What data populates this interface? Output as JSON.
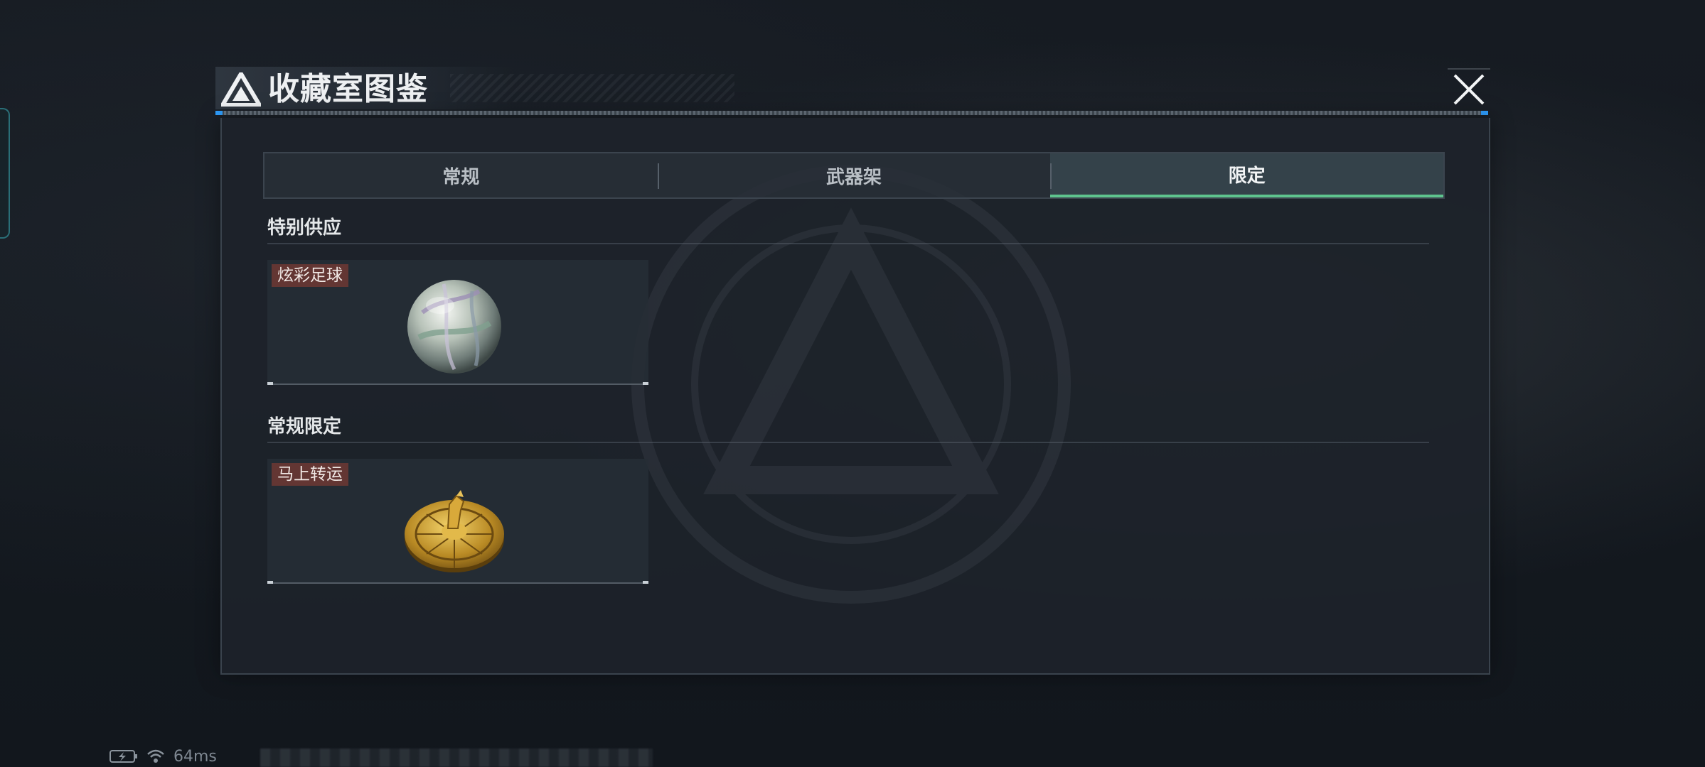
{
  "dialog": {
    "title": "收藏室图鉴",
    "close_icon": "close-icon"
  },
  "tabs": [
    {
      "label": "常规",
      "active": false
    },
    {
      "label": "武器架",
      "active": false
    },
    {
      "label": "限定",
      "active": true
    }
  ],
  "sections": [
    {
      "title": "特别供应",
      "items": [
        {
          "name": "炫彩足球",
          "icon": "iridescent-football-icon"
        }
      ]
    },
    {
      "title": "常规限定",
      "items": [
        {
          "name": "马上转运",
          "icon": "golden-horse-disc-icon"
        }
      ]
    }
  ],
  "status": {
    "ping": "64ms",
    "battery_icon": "battery-charging-icon",
    "wifi_icon": "wifi-icon"
  },
  "colors": {
    "active_tab_underline": "#5ec48e",
    "tag_background": "#6e3834",
    "panel_background": "#1d232a"
  }
}
